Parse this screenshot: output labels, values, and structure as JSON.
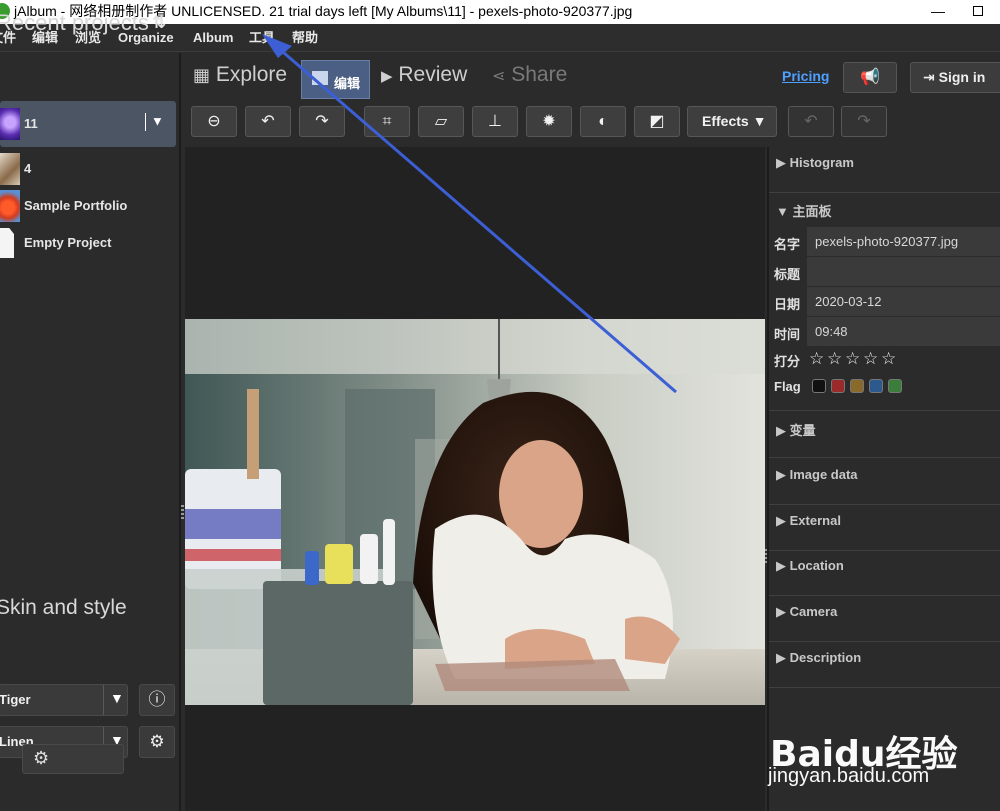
{
  "window": {
    "title": "jAlbum - 网络相册制作者 UNLICENSED. 21 trial days left [My Albums\\11] - pexels-photo-920377.jpg",
    "minimize_label": "—"
  },
  "menu": [
    {
      "label": "文件"
    },
    {
      "label": "编辑"
    },
    {
      "label": "浏览"
    },
    {
      "label": "Organize"
    },
    {
      "label": "Album"
    },
    {
      "label": "工具"
    },
    {
      "label": "帮助"
    }
  ],
  "left_panel": {
    "recent_title": "Recent projects",
    "sort_icon": "sort-icon",
    "projects": [
      {
        "label": "11",
        "selected": true
      },
      {
        "label": "4"
      },
      {
        "label": "Sample Portfolio"
      },
      {
        "label": "Empty Project"
      }
    ],
    "skin_title": "Skin and style",
    "skin_value": "Tiger",
    "style_value": "Linen",
    "info_icon": "info-icon",
    "gear_icon": "gear-icon"
  },
  "modes": {
    "explore": "Explore",
    "edit": "编辑",
    "review": "Review",
    "share": "Share"
  },
  "header": {
    "pricing": "Pricing",
    "sign_in": "Sign in"
  },
  "edit_toolbar": {
    "effects": "Effects"
  },
  "right_panel": {
    "histogram": "Histogram",
    "main_panel": "主面板",
    "fields": {
      "name_key": "名字",
      "name_val": "pexels-photo-920377.jpg",
      "title_key": "标题",
      "title_val": "",
      "date_key": "日期",
      "date_val": "2020-03-12",
      "time_key": "时间",
      "time_val": "09:48",
      "rating_key": "打分",
      "flag_key": "Flag"
    },
    "rating": 0,
    "flag_colors": [
      "#111111",
      "#9b2b2b",
      "#8a6a2a",
      "#2c5a8f",
      "#3b7d3b"
    ],
    "sections": [
      "变量",
      "Image data",
      "External",
      "Location",
      "Camera",
      "Description"
    ]
  },
  "watermark": {
    "brand": "Baidu经验",
    "url": "jingyan.baidu.com"
  },
  "colors": {
    "accent": "#4b5f84",
    "link": "#4da0ff",
    "annotation_arrow": "#3c5fd6"
  }
}
